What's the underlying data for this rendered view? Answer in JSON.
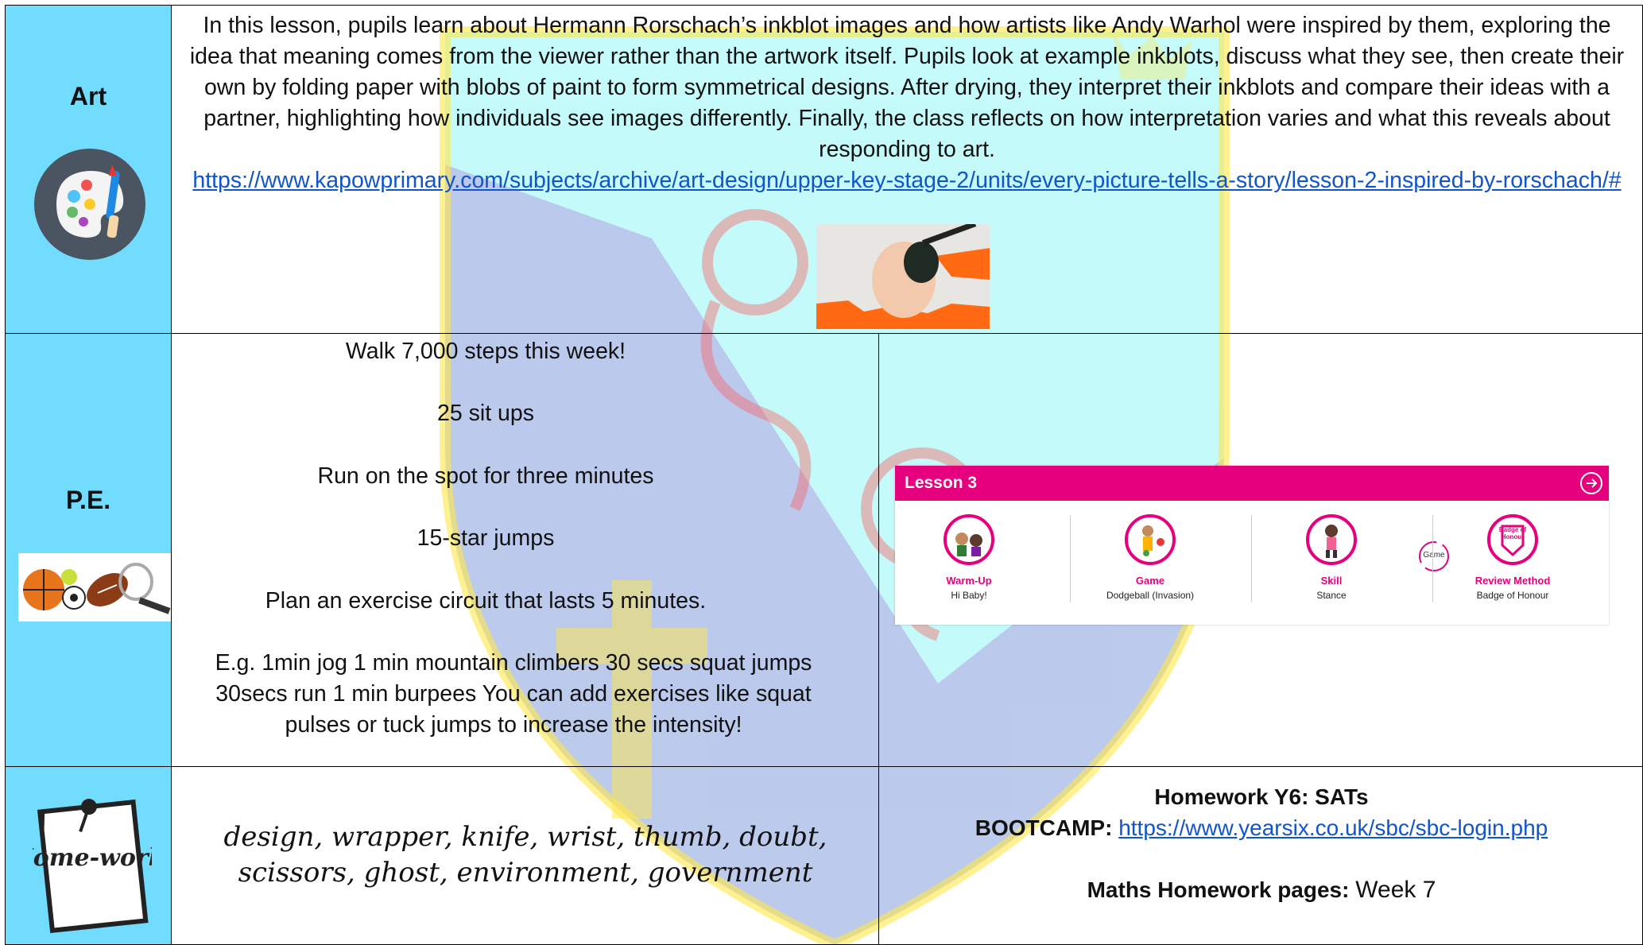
{
  "art": {
    "label": "Art",
    "description": "In this lesson, pupils learn about Hermann Rorschach’s inkblot images and how artists like Andy Warhol were inspired by them, exploring the idea that meaning comes from the viewer rather than the artwork itself.  Pupils look at example inkblots, discuss what they see, then create their own by folding paper with blobs of paint to form symmetrical designs. After drying, they interpret their inkblots and compare their ideas with a partner, highlighting how individuals see images differently. Finally, the class reflects on how interpretation varies and what this reveals about responding to art.",
    "link": "https://www.kapowprimary.com/subjects/archive/art-design/upper-key-stage-2/units/every-picture-tells-a-story/lesson-2-inspired-by-rorschach/#",
    "icon": "paint-palette-icon"
  },
  "pe": {
    "label": "P.E.",
    "lines": [
      "Walk 7,000 steps this week!",
      "25 sit ups",
      "Run on the spot for three minutes",
      "15-star jumps",
      "Plan an exercise circuit that lasts 5 minutes.",
      "E.g. 1min jog 1 min mountain climbers 30 secs squat jumps 30secs run 1 min burpees You can add exercises like squat pulses or tuck jumps to increase the intensity!"
    ],
    "icon": "sports-balls-icon",
    "lesson_card": {
      "title": "Lesson 3",
      "items": [
        {
          "title": "Warm-Up",
          "subtitle": "Hi Baby!"
        },
        {
          "title": "Game",
          "subtitle": "Dodgeball (Invasion)"
        },
        {
          "title": "Skill",
          "subtitle": "Stance"
        },
        {
          "title": "Review Method",
          "subtitle": "Badge of Honour"
        }
      ],
      "middle_label": "Game",
      "badge_text": "Badge of Honour"
    }
  },
  "homework": {
    "icon_text": "Home-work!",
    "spellings": "design, wrapper, knife, wrist, thumb, doubt, scissors, ghost, environment, government",
    "heading": "Homework Y6: SATs",
    "bootcamp_label": "BOOTCAMP:",
    "bootcamp_link": "https://www.yearsix.co.uk/sbc/sbc-login.php",
    "maths_label": "Maths Homework pages:",
    "maths_value": "Week 7"
  }
}
